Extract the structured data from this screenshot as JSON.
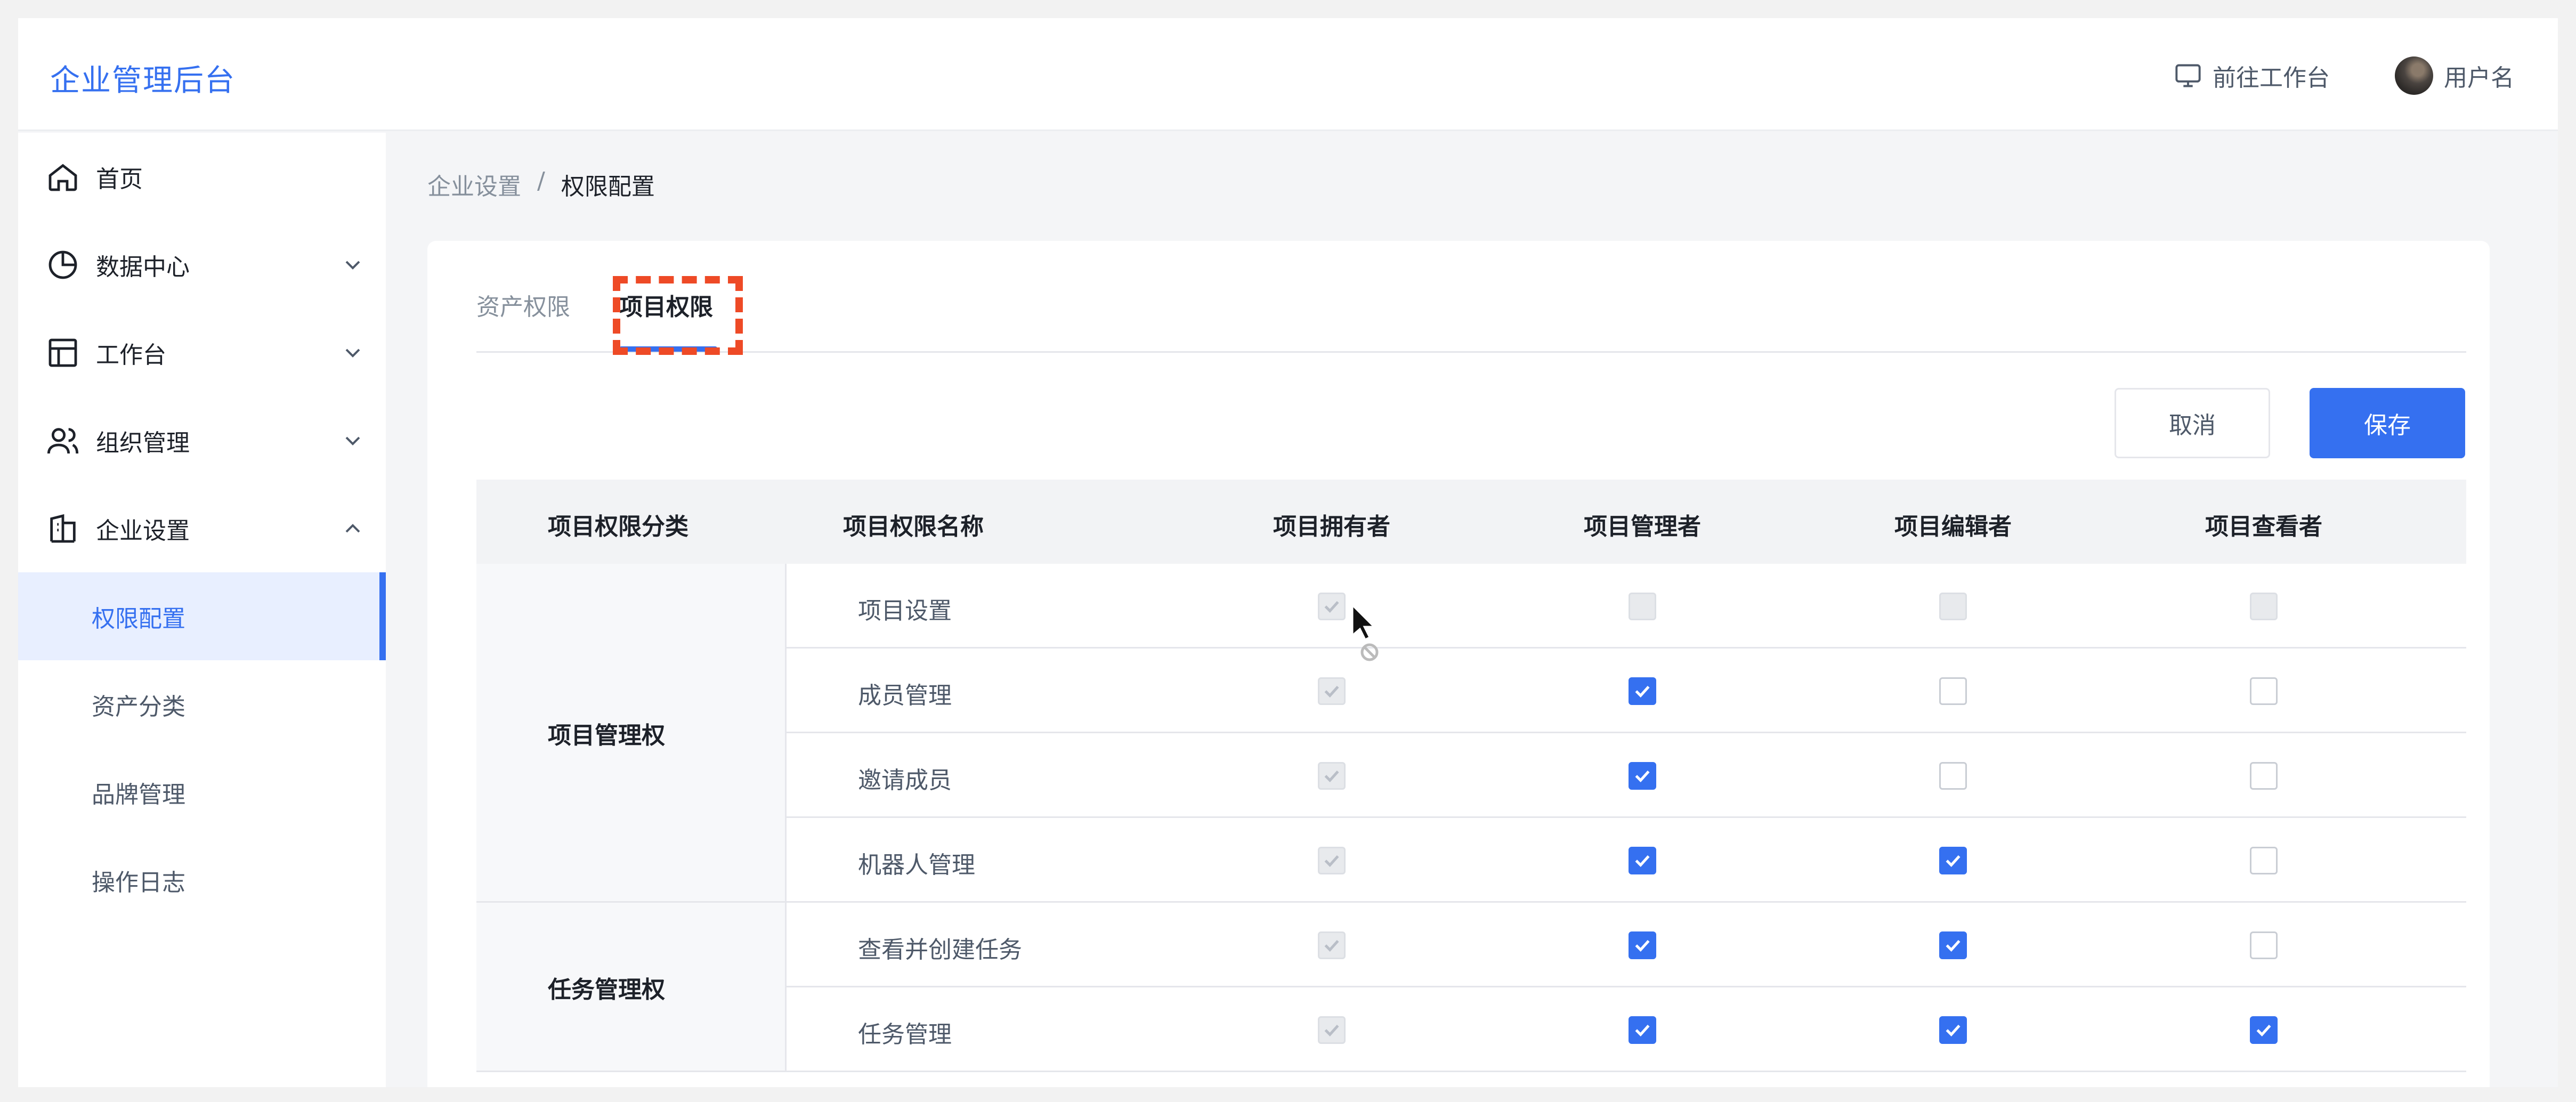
{
  "header": {
    "brand": "企业管理后台",
    "workbench_link": "前往工作台",
    "username": "用户名"
  },
  "sidebar": {
    "items": [
      {
        "label": "首页",
        "icon": "home-icon"
      },
      {
        "label": "数据中心",
        "icon": "pie-chart-icon",
        "expanded": false
      },
      {
        "label": "工作台",
        "icon": "layout-icon",
        "expanded": false
      },
      {
        "label": "组织管理",
        "icon": "users-icon",
        "expanded": false
      },
      {
        "label": "企业设置",
        "icon": "building-icon",
        "expanded": true
      }
    ],
    "subitems": [
      {
        "label": "权限配置",
        "active": true
      },
      {
        "label": "资产分类",
        "active": false
      },
      {
        "label": "品牌管理",
        "active": false
      },
      {
        "label": "操作日志",
        "active": false
      }
    ]
  },
  "breadcrumb": {
    "parent": "企业设置",
    "separator": "/",
    "current": "权限配置"
  },
  "tabs": [
    {
      "label": "资产权限",
      "active": false
    },
    {
      "label": "项目权限",
      "active": true
    }
  ],
  "actions": {
    "cancel": "取消",
    "save": "保存"
  },
  "table": {
    "headers": [
      "项目权限分类",
      "项目权限名称",
      "项目拥有者",
      "项目管理者",
      "项目编辑者",
      "项目查看者"
    ],
    "groups": [
      {
        "label": "项目管理权",
        "rows": [
          {
            "name": "项目设置",
            "owner": "disabled-checked",
            "admin": "disabled",
            "editor": "disabled",
            "viewer": "disabled"
          },
          {
            "name": "成员管理",
            "owner": "disabled-checked",
            "admin": "checked",
            "editor": "unchecked",
            "viewer": "unchecked"
          },
          {
            "name": "邀请成员",
            "owner": "disabled-checked",
            "admin": "checked",
            "editor": "unchecked",
            "viewer": "unchecked"
          },
          {
            "name": "机器人管理",
            "owner": "disabled-checked",
            "admin": "checked",
            "editor": "checked",
            "viewer": "unchecked"
          }
        ]
      },
      {
        "label": "任务管理权",
        "rows": [
          {
            "name": "查看并创建任务",
            "owner": "disabled-checked",
            "admin": "checked",
            "editor": "checked",
            "viewer": "unchecked"
          },
          {
            "name": "任务管理",
            "owner": "disabled-checked",
            "admin": "checked",
            "editor": "checked",
            "viewer": "checked"
          }
        ]
      }
    ]
  },
  "colors": {
    "accent": "#3570f0",
    "highlight": "#ee4a26"
  }
}
